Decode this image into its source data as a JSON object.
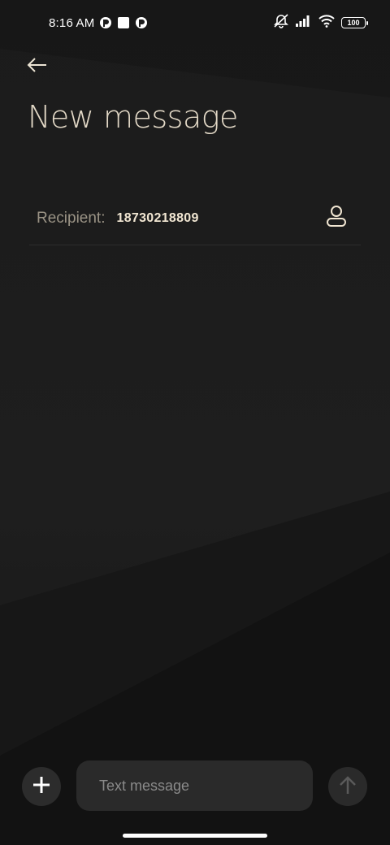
{
  "status_bar": {
    "time": "8:16 AM",
    "battery": "100",
    "icons": [
      "notification-app-icon",
      "notification-square-icon",
      "notification-app-icon",
      "silent-icon",
      "signal-icon",
      "wifi-icon",
      "battery-icon"
    ]
  },
  "header": {
    "title": "New message",
    "back_icon": "back-arrow-icon"
  },
  "recipient": {
    "label": "Recipient:",
    "value": "18730218809",
    "contact_icon": "person-icon"
  },
  "composer": {
    "placeholder": "Text message",
    "attach_icon": "plus-icon",
    "send_icon": "send-arrow-up-icon"
  },
  "colors": {
    "background": "#1b1b1b",
    "title": "#e2d8c6",
    "recipient_value": "#f1e6d2",
    "input_bg": "#2a2a2a"
  }
}
